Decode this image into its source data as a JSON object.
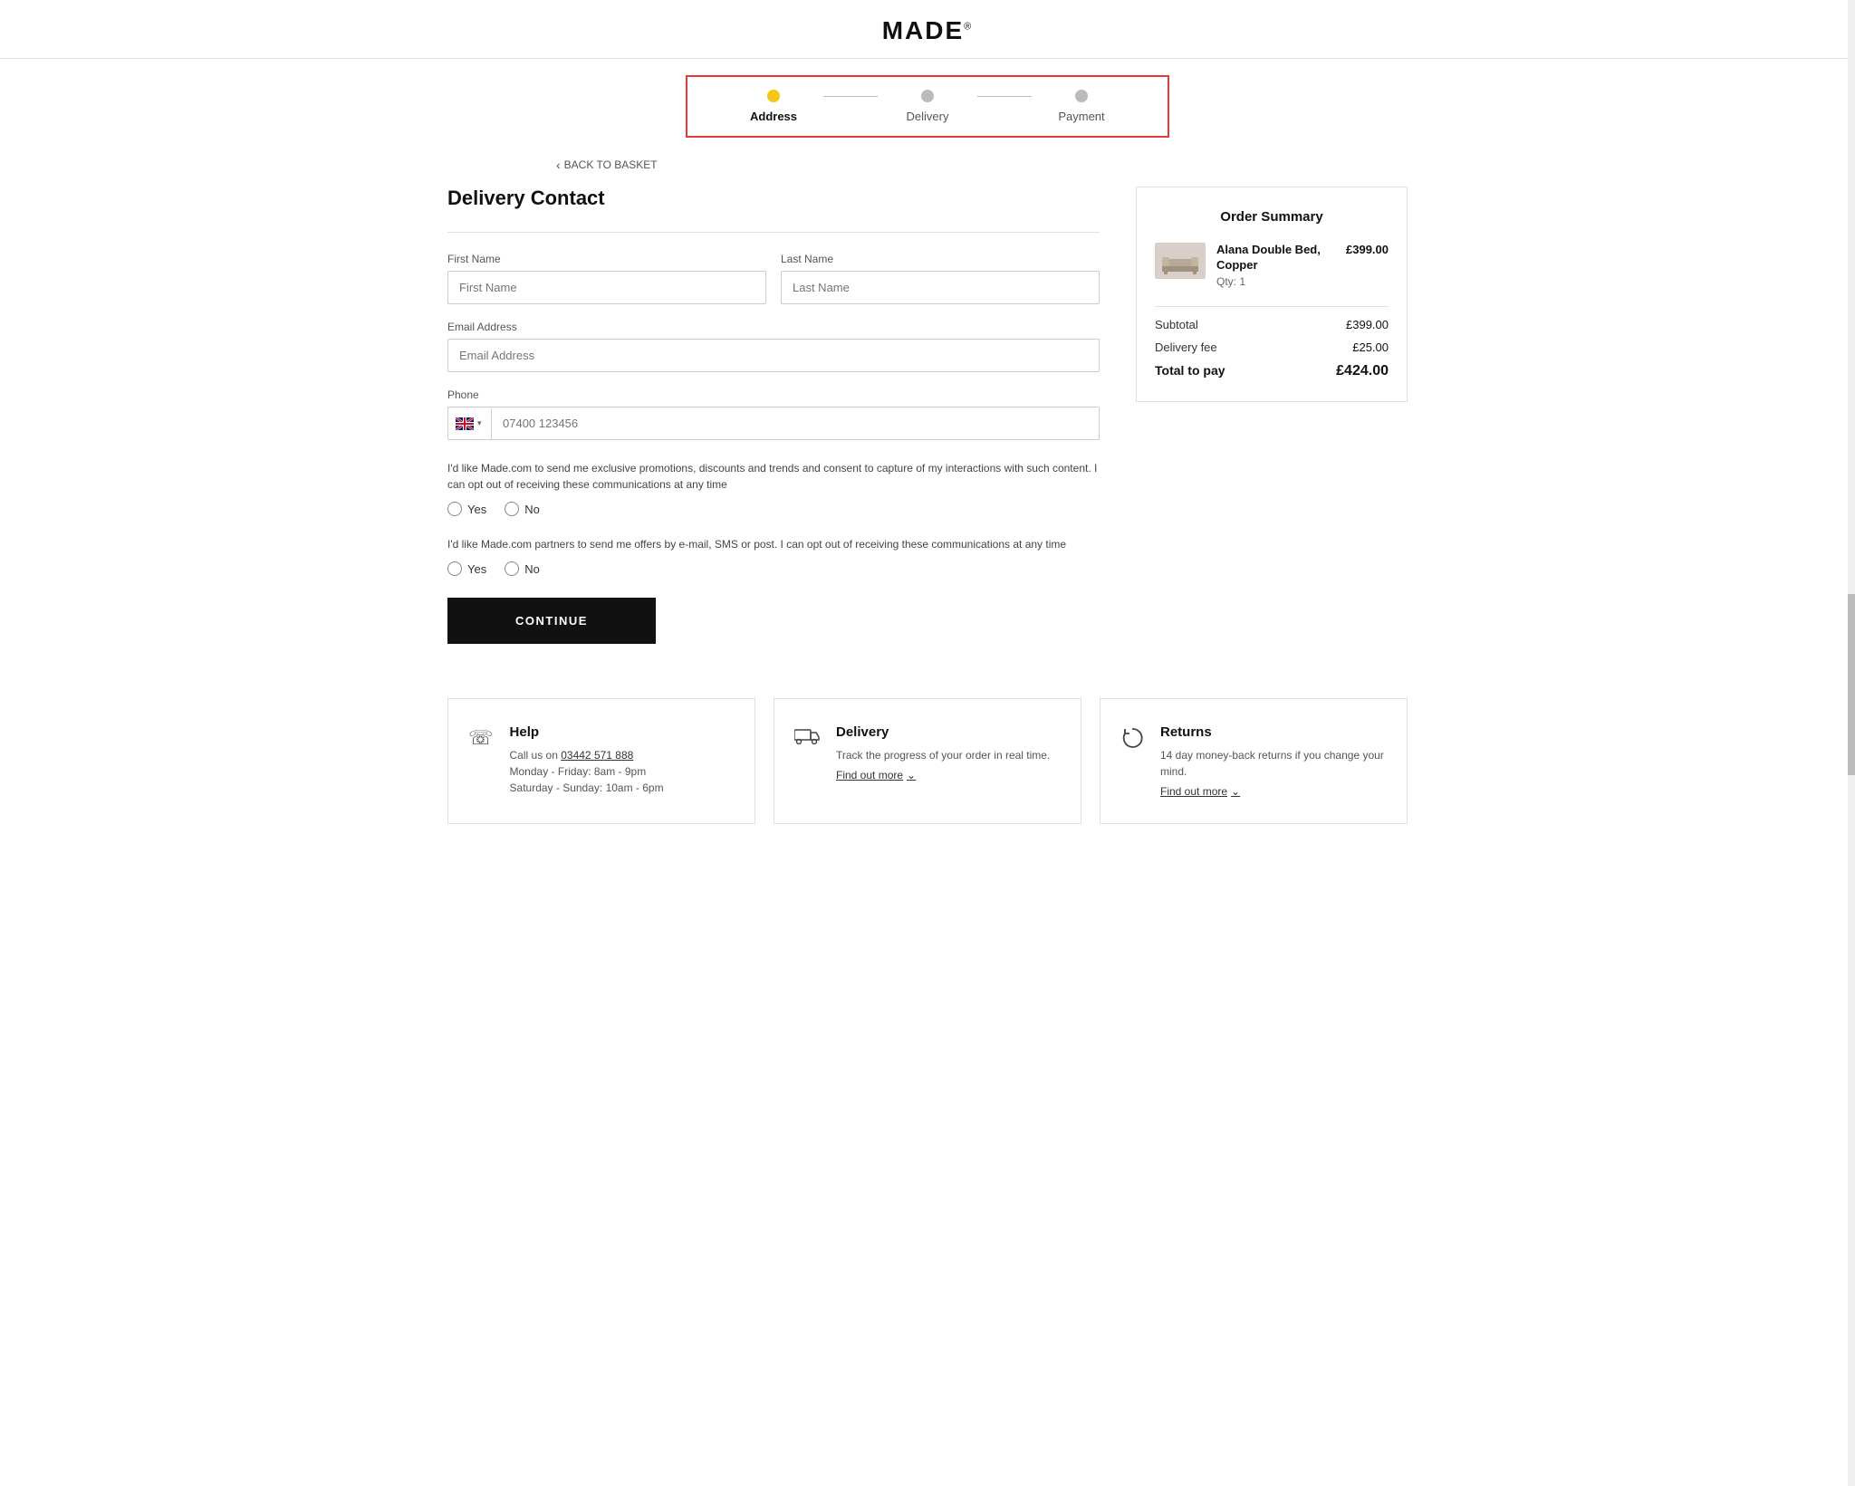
{
  "header": {
    "logo": "MADE",
    "logo_sup": "®"
  },
  "steps": {
    "step1": {
      "label": "Address",
      "state": "active"
    },
    "step2": {
      "label": "Delivery",
      "state": "inactive"
    },
    "step3": {
      "label": "Payment",
      "state": "inactive"
    }
  },
  "back_link": "BACK TO BASKET",
  "form": {
    "title": "Delivery Contact",
    "first_name_label": "First Name",
    "first_name_placeholder": "First Name",
    "last_name_label": "Last Name",
    "last_name_placeholder": "Last Name",
    "email_label": "Email Address",
    "email_placeholder": "Email Address",
    "phone_label": "Phone",
    "phone_placeholder": "07400 123456",
    "consent1_text": "I'd like Made.com to send me exclusive promotions, discounts and trends and consent to capture of my interactions with such content. I can opt out of receiving these communications at any time",
    "consent1_yes": "Yes",
    "consent1_no": "No",
    "consent2_text": "I'd like Made.com partners to send me offers by e-mail, SMS or post. I can opt out of receiving these communications at any time",
    "consent2_yes": "Yes",
    "consent2_no": "No",
    "continue_btn": "CONTINUE"
  },
  "order_summary": {
    "title": "Order Summary",
    "item_name": "Alana Double Bed, Copper",
    "item_qty": "Qty: 1",
    "item_price": "£399.00",
    "subtotal_label": "Subtotal",
    "subtotal_value": "£399.00",
    "delivery_label": "Delivery fee",
    "delivery_value": "£25.00",
    "total_label": "Total to pay",
    "total_value": "£424.00"
  },
  "footer": {
    "card1": {
      "title": "Help",
      "phone_label": "Call us on",
      "phone": "03442 571 888",
      "hours1": "Monday - Friday: 8am - 9pm",
      "hours2": "Saturday - Sunday: 10am - 6pm"
    },
    "card2": {
      "title": "Delivery",
      "text": "Track the progress of your order in real time.",
      "link": "Find out more"
    },
    "card3": {
      "title": "Returns",
      "text": "14 day money-back returns if you change your mind.",
      "link": "Find out more"
    }
  }
}
